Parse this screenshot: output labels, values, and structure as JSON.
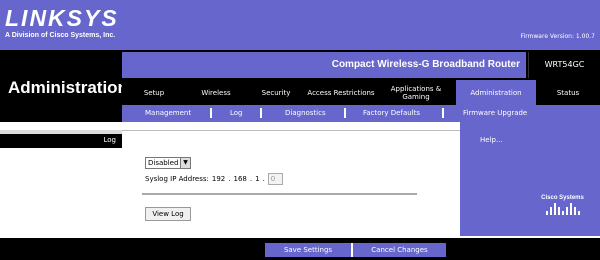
{
  "branding": {
    "logo_text": "LINKSYS",
    "logo_sub": "A Division of Cisco Systems, Inc.",
    "firmware": "Firmware Version: 1.00.7"
  },
  "header": {
    "section_title": "Administration",
    "product_name": "Compact Wireless-G Broadband Router",
    "model": "WRT54GC"
  },
  "tabs": [
    {
      "label": "Setup"
    },
    {
      "label": "Wireless"
    },
    {
      "label": "Security"
    },
    {
      "label": "Access Restrictions"
    },
    {
      "label": "Applications & Gaming"
    },
    {
      "label": "Administration"
    },
    {
      "label": "Status"
    }
  ],
  "subtabs": [
    {
      "label": "Management"
    },
    {
      "label": "Log"
    },
    {
      "label": "Diagnostics"
    },
    {
      "label": "Factory Defaults"
    },
    {
      "label": "Firmware Upgrade"
    }
  ],
  "sidebar": {
    "section_label": "Log"
  },
  "log": {
    "status_select": "Disabled",
    "syslog_label": "Syslog IP Address:",
    "ip_octet1": "192",
    "ip_octet2": "168",
    "ip_octet3": "1",
    "ip_octet4": "0",
    "view_log_button": "View Log"
  },
  "help": {
    "label": "Help..."
  },
  "footer": {
    "save_button": "Save Settings",
    "cancel_button": "Cancel Changes",
    "cisco_text": "Cisco Systems"
  }
}
